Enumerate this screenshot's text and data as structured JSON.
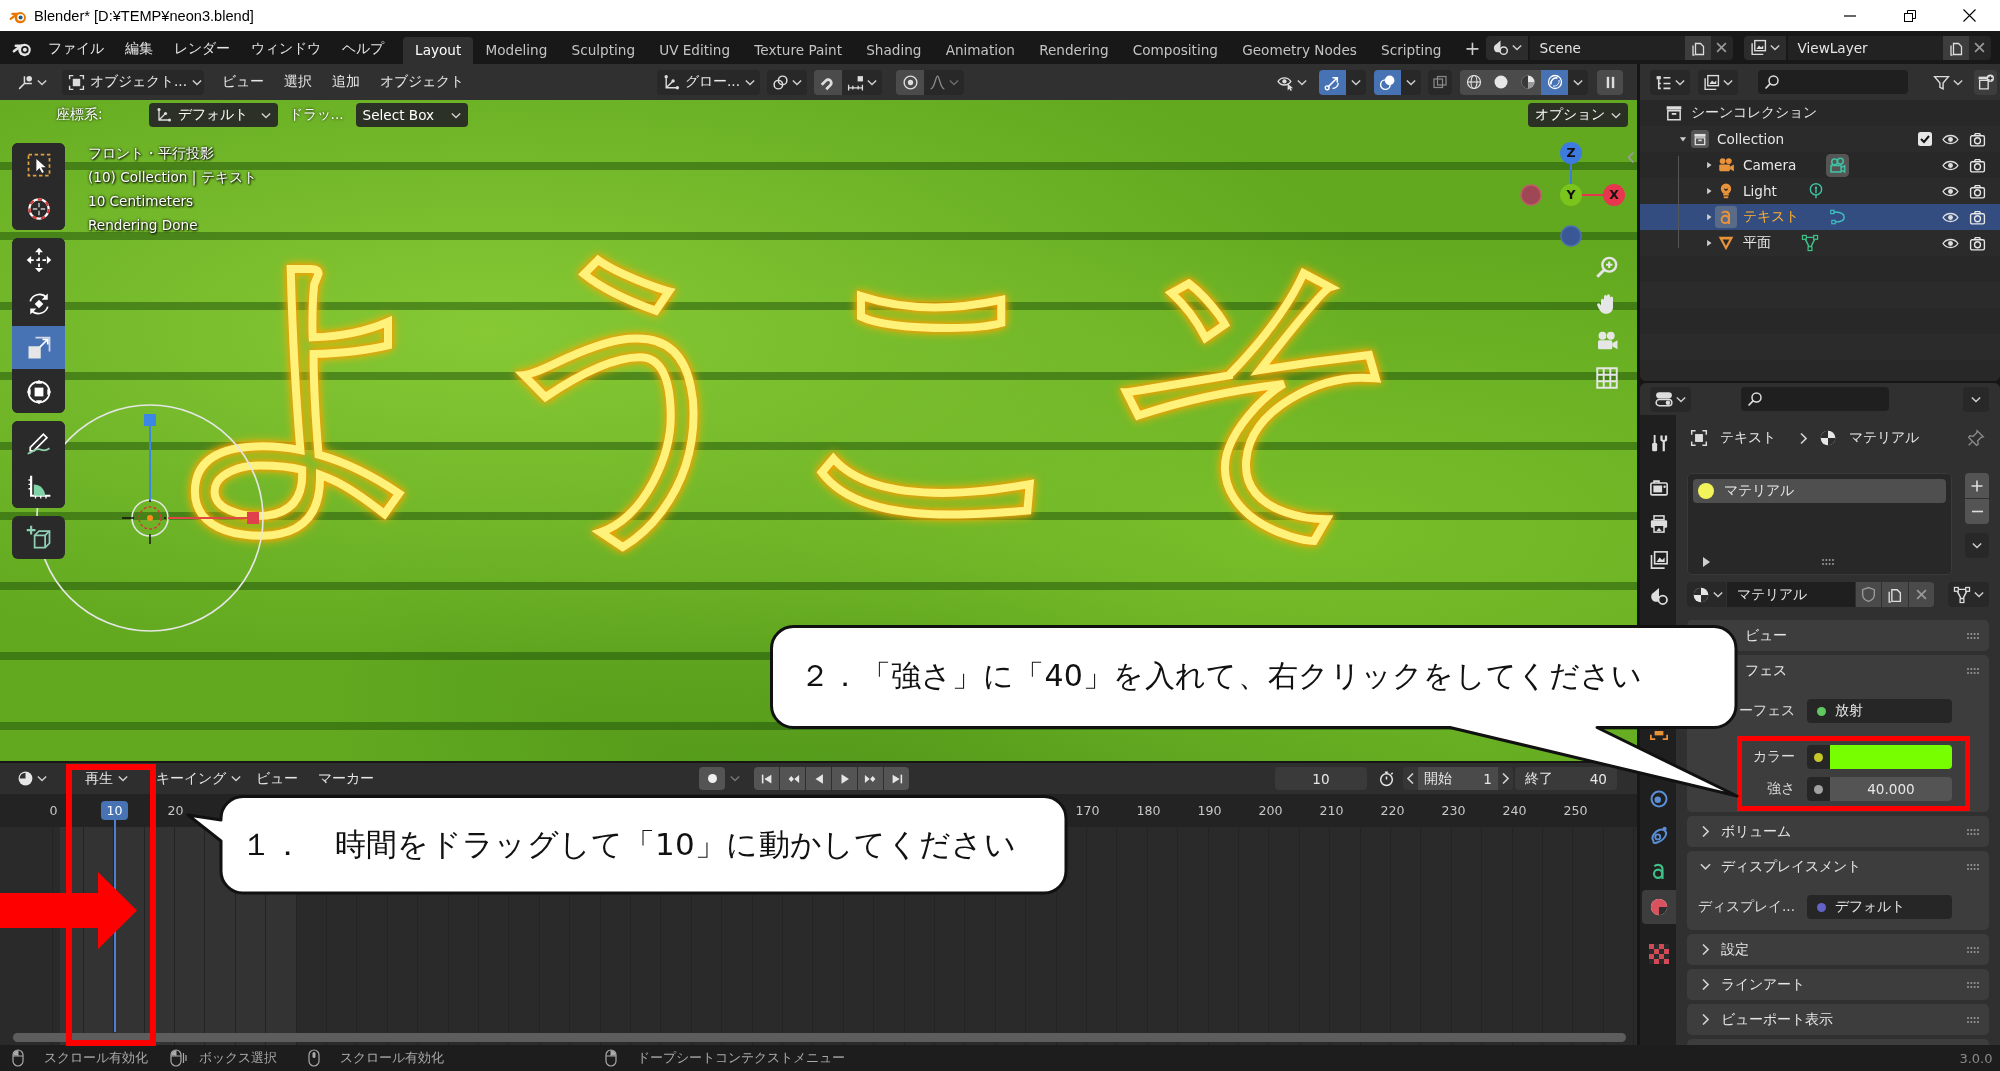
{
  "window": {
    "title": "Blender* [D:¥TEMP¥neon3.blend]"
  },
  "topbar": {
    "menus": [
      "ファイル",
      "編集",
      "レンダー",
      "ウィンドウ",
      "ヘルプ"
    ],
    "workspaces": [
      {
        "label": "Layout",
        "selected": true
      },
      {
        "label": "Modeling",
        "selected": false
      },
      {
        "label": "Sculpting",
        "selected": false
      },
      {
        "label": "UV Editing",
        "selected": false
      },
      {
        "label": "Texture Paint",
        "selected": false
      },
      {
        "label": "Shading",
        "selected": false
      },
      {
        "label": "Animation",
        "selected": false
      },
      {
        "label": "Rendering",
        "selected": false
      },
      {
        "label": "Compositing",
        "selected": false
      },
      {
        "label": "Geometry Nodes",
        "selected": false
      },
      {
        "label": "Scripting",
        "selected": false
      }
    ],
    "add_workspace": "+",
    "scene": "Scene",
    "view_layer": "ViewLayer"
  },
  "viewport": {
    "header": {
      "mode": "オブジェクト...",
      "menus": [
        "ビュー",
        "選択",
        "追加",
        "オブジェクト"
      ],
      "orientation": "グロー...",
      "gizmos_on": true,
      "overlays_on": true,
      "xray_on": false,
      "shading": [
        {
          "kind": "wireframe",
          "selected": false
        },
        {
          "kind": "solid",
          "selected": false
        },
        {
          "kind": "material",
          "selected": false
        },
        {
          "kind": "rendered",
          "selected": true
        }
      ]
    },
    "tool_settings": {
      "orientation_label": "座標系:",
      "orientation": "デフォルト",
      "drag_label": "ドラッ...",
      "drag": "Select Box",
      "options": "オプション"
    },
    "tool_groups": [
      [
        {
          "kind": "select_box",
          "selected": false
        },
        {
          "kind": "cursor",
          "selected": false
        }
      ],
      [
        {
          "kind": "move",
          "selected": false
        },
        {
          "kind": "rotate",
          "selected": false
        },
        {
          "kind": "scale",
          "selected": true
        },
        {
          "kind": "transform",
          "selected": false
        }
      ],
      [
        {
          "kind": "annotate",
          "selected": false
        },
        {
          "kind": "measure",
          "selected": false
        }
      ],
      [
        {
          "kind": "add_cube",
          "selected": false
        }
      ]
    ],
    "overlay_lines": [
      "フロント・平行投影",
      "(10) Collection | テキスト",
      "10 Centimeters",
      "Rendering Done"
    ],
    "scene_text": "ようこそ",
    "axes": [
      {
        "label": "Z"
      },
      {
        "label": "Y"
      },
      {
        "label": "X"
      }
    ]
  },
  "outliner": {
    "items": [
      {
        "label": "シーンコレクション",
        "kind": "scene_collection",
        "selected": false,
        "children": [
          {
            "label": "Collection",
            "kind": "collection",
            "expanded": true,
            "checked": true,
            "selected": false,
            "children": [
              {
                "label": "Camera",
                "kind": "camera",
                "expanded": false,
                "selected": false
              },
              {
                "label": "Light",
                "kind": "light",
                "expanded": false,
                "selected": false
              },
              {
                "label": "テキスト",
                "kind": "text",
                "expanded": false,
                "selected": true
              },
              {
                "label": "平面",
                "kind": "mesh",
                "expanded": false,
                "selected": false
              }
            ]
          }
        ]
      }
    ]
  },
  "properties": {
    "tabs": [
      {
        "kind": "tool",
        "selected": false
      },
      {
        "kind": "render",
        "selected": false
      },
      {
        "kind": "output",
        "selected": false
      },
      {
        "kind": "view_layer",
        "selected": false
      },
      {
        "kind": "scene",
        "selected": false
      },
      {
        "kind": "object",
        "selected": false
      },
      {
        "kind": "physics",
        "selected": false
      },
      {
        "kind": "constraints",
        "selected": false
      },
      {
        "kind": "data",
        "selected": false
      },
      {
        "kind": "material",
        "selected": true
      },
      {
        "kind": "texture",
        "selected": false
      }
    ],
    "breadcrumb": [
      "テキスト",
      "マテリアル"
    ],
    "material_slots": [
      {
        "label": "マテリアル",
        "selected": true
      }
    ],
    "material": "マテリアル",
    "preview_header": "ビュー",
    "surface": {
      "title": "フェス",
      "rows": [
        {
          "kind": "menu",
          "label": "ーフェス",
          "socket": {
            "color": "#5fc85f"
          },
          "value": "放射"
        },
        {
          "kind": "color",
          "label": "カラー",
          "socket": {
            "color": "#c7c729"
          },
          "swatch": {
            "color": "#77ff00"
          }
        },
        {
          "kind": "number",
          "label": "強さ",
          "socket": {
            "color": "#a1a1a1"
          },
          "value": "40.000"
        }
      ]
    },
    "panels": [
      {
        "title": "ボリューム",
        "expanded": false
      },
      {
        "title": "ディスプレイスメント",
        "expanded": true,
        "rows": [
          {
            "kind": "menu",
            "label": "ディスプレイ...",
            "socket": {
              "color": "#6363c7"
            },
            "value": "デフォルト"
          }
        ]
      },
      {
        "title": "設定",
        "expanded": false
      },
      {
        "title": "ラインアート",
        "expanded": false
      },
      {
        "title": "ビューポート表示",
        "expanded": false
      }
    ]
  },
  "timeline": {
    "menus": [
      "再生",
      "キーイング",
      "ビュー",
      "マーカー"
    ],
    "current_frame": "10",
    "start_label": "開始",
    "start": "1",
    "end_label": "終了",
    "end": "40",
    "ruler_left": [
      {
        "label": "0",
        "selected": false
      },
      {
        "label": "10",
        "selected": true
      },
      {
        "label": "20",
        "selected": false
      }
    ],
    "ruler_right": [
      {
        "label": "170",
        "selected": false
      },
      {
        "label": "180",
        "selected": false
      },
      {
        "label": "190",
        "selected": false
      },
      {
        "label": "200",
        "selected": false
      },
      {
        "label": "210",
        "selected": false
      },
      {
        "label": "220",
        "selected": false
      },
      {
        "label": "230",
        "selected": false
      },
      {
        "label": "240",
        "selected": false
      },
      {
        "label": "250",
        "selected": false
      }
    ]
  },
  "status_bar": {
    "hints": [
      {
        "kind": "mouse_left",
        "label": "スクロール有効化"
      },
      {
        "kind": "mouse_drag",
        "label": "ボックス選択"
      },
      {
        "kind": "mouse_middle",
        "label": "スクロール有効化"
      },
      {
        "kind": "mouse_right",
        "label": "ドープシートコンテクストメニュー"
      }
    ],
    "version": "3.0.0"
  },
  "annotations": {
    "callouts": [
      "１．　時間をドラッグして「10」に動かしてください",
      "２．「強さ」に「40」を入れて、右クリックをしてください"
    ]
  }
}
